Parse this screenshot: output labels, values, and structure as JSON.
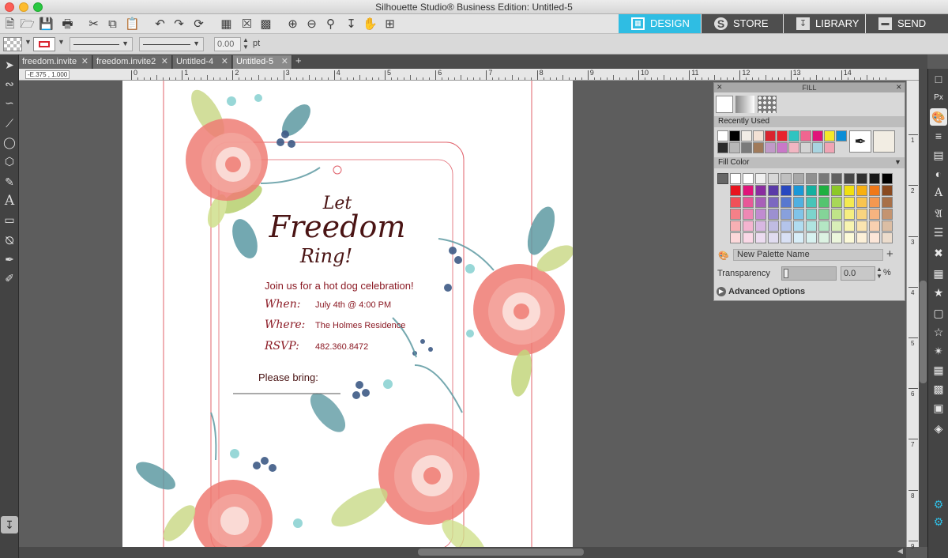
{
  "window": {
    "title": "Silhouette Studio® Business Edition: Untitled-5"
  },
  "nav_tabs": [
    {
      "label": "DESIGN",
      "icon": "grid-icon"
    },
    {
      "label": "STORE",
      "icon": "silhouette-s-icon"
    },
    {
      "label": "LIBRARY",
      "icon": "library-icon"
    },
    {
      "label": "SEND",
      "icon": "cutter-icon"
    }
  ],
  "colors": {
    "accent": "#2fbde3",
    "invite_text": "#8b1a24",
    "title_text": "#4a1414",
    "guide": "#e0606a"
  },
  "properties": {
    "line_weight": "0.00",
    "unit": "pt"
  },
  "doc_tabs": [
    {
      "label": "freedom.invite",
      "active": false
    },
    {
      "label": "freedom.invite2",
      "active": false
    },
    {
      "label": "Untitled-4",
      "active": false
    },
    {
      "label": "Untitled-5",
      "active": true
    }
  ],
  "ruler": {
    "coords": "-E.375 , 1.000",
    "h_ticks": [
      "0",
      "1",
      "2",
      "3",
      "4",
      "5",
      "6",
      "7",
      "8",
      "9",
      "10",
      "11",
      "12",
      "13",
      "14"
    ],
    "v_ticks": [
      "1",
      "2",
      "3",
      "4",
      "5",
      "6",
      "7",
      "8",
      "9"
    ]
  },
  "invite": {
    "title_let": "Let",
    "title_freedom": "Freedom",
    "title_ring": "Ring!",
    "intro": "Join us for a hot dog celebration!",
    "when_label": "When:",
    "when_value": "July 4th @ 4:00 PM",
    "where_label": "Where:",
    "where_value": "The Holmes Residence",
    "rsvp_label": "RSVP:",
    "rsvp_value": "482.360.8472",
    "bring_label": "Please bring:"
  },
  "fill_panel": {
    "title": "FILL",
    "recently_used_label": "Recently Used",
    "fill_color_label": "Fill Color",
    "palette_name": "New Palette Name",
    "transparency_label": "Transparency",
    "transparency_value": "0.0",
    "transparency_unit": "%",
    "advanced_label": "Advanced Options",
    "recent_row1": [
      "#ffffff",
      "#000000",
      "#f2ede6",
      "#f4e1d4",
      "#d9242f",
      "#e8222d",
      "#2fc4c1",
      "#f06690",
      "#e0147a",
      "#f4e82a",
      "#0a8dd6"
    ],
    "recent_row2": [
      "#2b2b2b",
      "#b8b8b8",
      "#7a7a7a",
      "#a07a5a",
      "#c09ac8",
      "#c978c8",
      "#f2b6c2",
      "#d4d4d4",
      "#a8d4e0",
      "#f0a4b4"
    ],
    "recent_big": "#f2ede3",
    "grid": [
      [
        "#ffffff",
        "#ffffff",
        "#f0f0f0",
        "#d8d8d8",
        "#c0c0c0",
        "#a8a8a8",
        "#909090",
        "#787878",
        "#606060",
        "#484848",
        "#303030",
        "#181818",
        "#000000"
      ],
      [
        "#e8141e",
        "#e0147a",
        "#8a2da0",
        "#5a3aa8",
        "#2848c0",
        "#1a98d8",
        "#14b0a0",
        "#1eb040",
        "#8cc828",
        "#f0e010",
        "#f8b010",
        "#f07818",
        "#8a4a20"
      ],
      [
        "#f05058",
        "#e85898",
        "#a860b8",
        "#7c68c0",
        "#5878d0",
        "#50b0e0",
        "#48c4b8",
        "#54c470",
        "#a8d858",
        "#f4ea50",
        "#f8c450",
        "#f49850",
        "#a87048"
      ],
      [
        "#f48088",
        "#ee88b4",
        "#c08cd0",
        "#9c90d0",
        "#88a0dc",
        "#80c4e8",
        "#7cd4cc",
        "#84d498",
        "#c0e488",
        "#f6ee80",
        "#f8d480",
        "#f6b480",
        "#c49470"
      ],
      [
        "#f8b0b4",
        "#f4b4d0",
        "#d8b8e2",
        "#c0bce2",
        "#b4c4ea",
        "#b0dcf0",
        "#b0e4e0",
        "#b4e6c4",
        "#d8eeb8",
        "#f8f4b0",
        "#fae4b0",
        "#f8d0b0",
        "#dcbea4"
      ],
      [
        "#fcd8da",
        "#fad8e6",
        "#ecdcf0",
        "#e0dcf0",
        "#d8e0f4",
        "#d8eef8",
        "#d8f2f0",
        "#dcf2e2",
        "#ecf6dc",
        "#fcfad8",
        "#fcf0d8",
        "#fce6d8",
        "#ecdccc"
      ]
    ]
  }
}
